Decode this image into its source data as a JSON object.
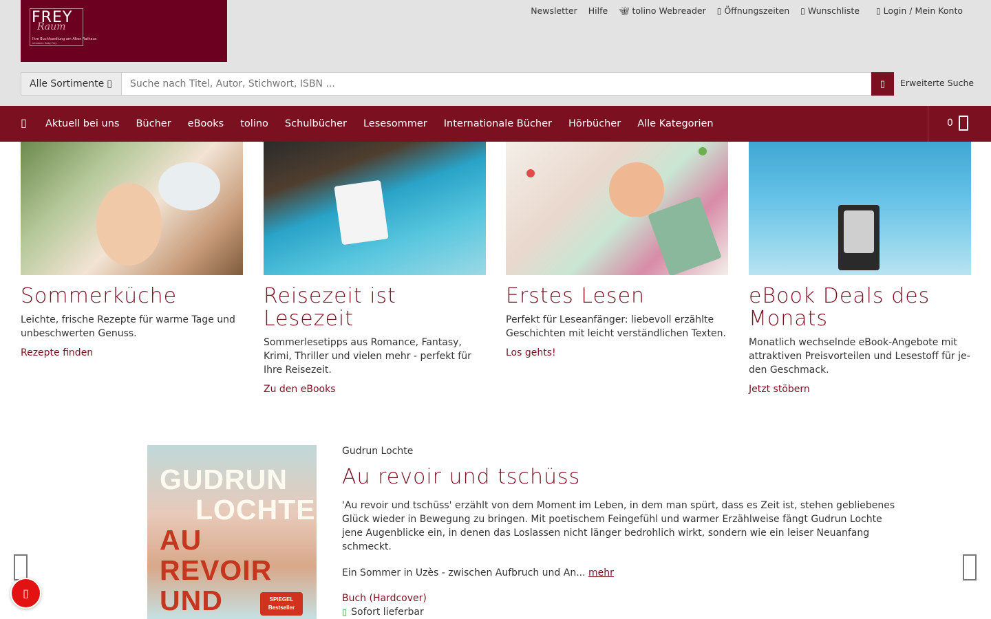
{
  "logo": {
    "title": "FREY",
    "script": "Raum",
    "subtitle": "Ihre Buchhandlung am Alten Rathaus",
    "owner": "Inhaberin Gaby Frey"
  },
  "top_links": [
    {
      "label": "Newsletter",
      "icon": ""
    },
    {
      "label": "Hilfe",
      "icon": ""
    },
    {
      "label": "tolino Webreader",
      "icon": "butterfly-icon"
    },
    {
      "label": "Öffnungszeiten",
      "icon": "clock-icon"
    },
    {
      "label": "Wunschliste",
      "icon": "heart-icon"
    },
    {
      "label": "Login / Mein Konto",
      "icon": "user-icon"
    }
  ],
  "search": {
    "sortiment_label": "Alle Sortimente",
    "placeholder": "Suche nach Titel, Autor, Stichwort, ISBN ...",
    "advanced_label": "Erweiterte Suche"
  },
  "nav": {
    "items": [
      "Aktuell bei uns",
      "Bücher",
      "eBooks",
      "tolino",
      "Schulbücher",
      "Lesesommer",
      "Internationale Bücher",
      "Hörbücher",
      "Alle Kategorien"
    ],
    "cart_count": "0"
  },
  "teasers": [
    {
      "title": "Sommerküche",
      "text": "Leichte, frische Rezepte für warme Tage und unbeschwerten Genuss.",
      "link": "Rezepte finden"
    },
    {
      "title": "Reisezeit ist Lesezeit",
      "text": "Sommerlesetipps aus Romance, Fantasy, Krimi, Thriller und vielen mehr - perfekt für Ihre Reisezeit.",
      "link": "Zu den eBooks"
    },
    {
      "title": "Erstes Lesen",
      "text": "Perfekt für Leseanfänger: liebevoll erzählte Geschichten mit leicht verständlichen Texten.",
      "link": "Los gehts!"
    },
    {
      "title": "eBook Deals des Monats",
      "text": "Monatlich wechselnde eBook-Angebote mit attraktiven Preisvorteilen und Lesestoff für je-den Geschmack.",
      "link": "Jetzt stöbern"
    }
  ],
  "featured_book": {
    "cover": {
      "line1": "GUDRUN",
      "line2": "LOCHTE",
      "line3": "AU",
      "line4": "REVOIR",
      "line5": "UND",
      "badge_line1": "SPIEGEL",
      "badge_line2": "Bestseller"
    },
    "author": "Gudrun Lochte",
    "title": "Au revoir und tschüss",
    "description": "'Au revoir und tschüss' erzählt von dem Moment im Leben, in dem man spürt, dass es Zeit ist, stehen gebliebenes Glück wieder in Bewegung zu bringen. Mit poetischem Feingefühl und warmer Erzählweise fängt Gudrun Lochte jene Augenblicke ein, in denen das Loslassen nicht länger bedrohlich wirkt, sondern wie ein leiser Neuanfang schmeckt.",
    "teaser": "Ein Sommer in Uzès - zwischen Aufbruch und An...",
    "more_label": "mehr",
    "format": "Buch (Hardcover)",
    "availability": "Sofort lieferbar"
  },
  "colors": {
    "brand": "#7a1020",
    "header_bg": "#e3e3e3",
    "fab": "#e21212"
  }
}
